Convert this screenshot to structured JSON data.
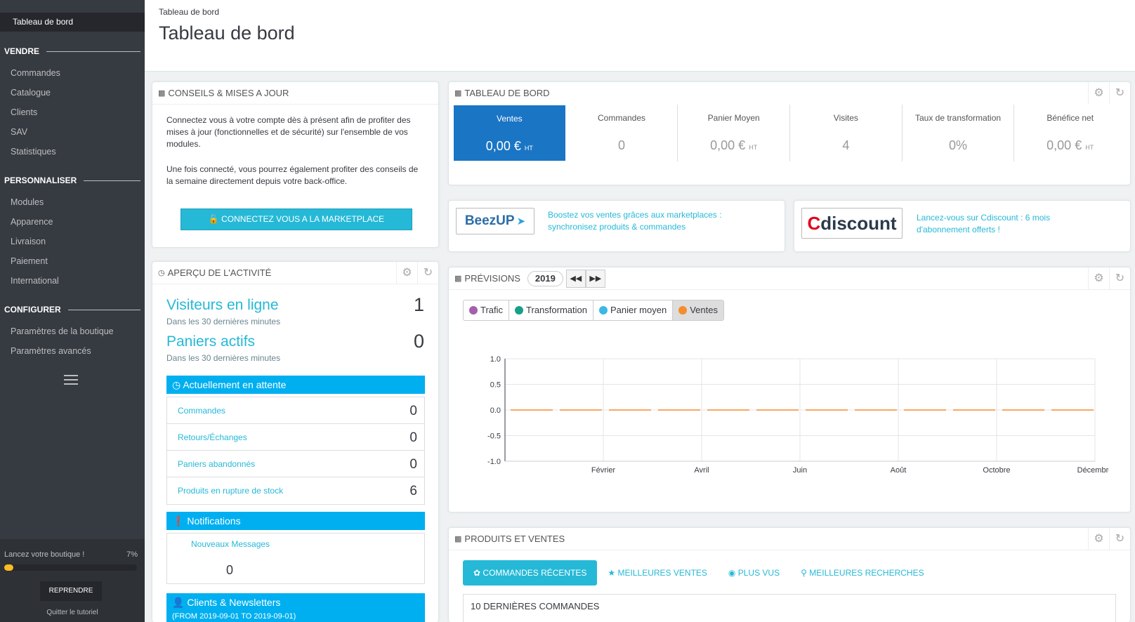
{
  "sidebar": {
    "active": "Tableau de bord",
    "sections": [
      {
        "title": "VENDRE",
        "items": [
          "Commandes",
          "Catalogue",
          "Clients",
          "SAV",
          "Statistiques"
        ]
      },
      {
        "title": "PERSONNALISER",
        "items": [
          "Modules",
          "Apparence",
          "Livraison",
          "Paiement",
          "International"
        ]
      },
      {
        "title": "CONFIGURER",
        "items": [
          "Paramètres de la boutique",
          "Paramètres avancés"
        ]
      }
    ],
    "launch_label": "Lancez votre boutique !",
    "launch_percent": "7%",
    "launch_progress": 0.07,
    "resume_button": "REPRENDRE",
    "quit_tutorial": "Quitter le tutoriel"
  },
  "header": {
    "breadcrumb": "Tableau de bord",
    "title": "Tableau de bord"
  },
  "tips": {
    "title": "CONSEILS & MISES A JOUR",
    "para1": "Connectez vous à votre compte dès à présent afin de profiter des mises à jour (fonctionnelles et de sécurité) sur l'ensemble de vos modules.",
    "para2": "Une fois connecté, vous pourrez également profiter des conseils de la semaine directement depuis votre back-office.",
    "button": "CONNECTEZ VOUS A LA MARKETPLACE PRESTASHOP"
  },
  "activity": {
    "title": "APERÇU DE L'ACTIVITÉ",
    "visitors_label": "Visiteurs en ligne",
    "visitors_sub": "Dans les 30 dernières minutes",
    "visitors_value": "1",
    "carts_label": "Paniers actifs",
    "carts_sub": "Dans les 30 dernières minutes",
    "carts_value": "0",
    "pending_title": "Actuellement en attente",
    "pending": [
      {
        "label": "Commandes",
        "value": "0"
      },
      {
        "label": "Retours/Échanges",
        "value": "0"
      },
      {
        "label": "Paniers abandonnés",
        "value": "0"
      },
      {
        "label": "Produits en rupture de stock",
        "value": "6"
      }
    ],
    "notifications_title": "Notifications",
    "new_messages_label": "Nouveaux Messages",
    "new_messages_value": "0",
    "clients_title": "Clients & Newsletters",
    "clients_range": "(FROM 2019-09-01 TO 2019-09-01)"
  },
  "dashboard": {
    "title": "TABLEAU DE BORD",
    "kpis": [
      {
        "label": "Ventes",
        "value": "0,00 €",
        "suffix": "HT"
      },
      {
        "label": "Commandes",
        "value": "0",
        "suffix": ""
      },
      {
        "label": "Panier Moyen",
        "value": "0,00 €",
        "suffix": "HT"
      },
      {
        "label": "Visites",
        "value": "4",
        "suffix": ""
      },
      {
        "label": "Taux de transformation",
        "value": "0%",
        "suffix": ""
      },
      {
        "label": "Bénéfice net",
        "value": "0,00 €",
        "suffix": "HT"
      }
    ]
  },
  "partners": {
    "beezup_logo": "BeezUP",
    "beezup_text": "Boostez vos ventes grâces aux marketplaces : synchronisez produits & commandes",
    "cdiscount_logo_c": "C",
    "cdiscount_logo_rest": "discount",
    "cdiscount_text": "Lancez-vous sur Cdiscount : 6 mois d'abonnement offerts !"
  },
  "previsions": {
    "title": "PRÉVISIONS",
    "year": "2019",
    "legend": [
      {
        "label": "Trafic",
        "color": "#a55eab"
      },
      {
        "label": "Transformation",
        "color": "#17a087"
      },
      {
        "label": "Panier moyen",
        "color": "#3ab8e6"
      },
      {
        "label": "Ventes",
        "color": "#f68c2d"
      }
    ]
  },
  "chart_data": {
    "type": "line",
    "x": [
      "Janvier",
      "Février",
      "Mars",
      "Avril",
      "Mai",
      "Juin",
      "Juillet",
      "Août",
      "Septembre",
      "Octobre",
      "Novembre",
      "Décembre"
    ],
    "x_tick_labels": [
      "Février",
      "Avril",
      "Juin",
      "Août",
      "Octobre",
      "Décembre"
    ],
    "series": [
      {
        "name": "Ventes",
        "values": [
          0,
          0,
          0,
          0,
          0,
          0,
          0,
          0,
          0,
          0,
          0,
          0
        ],
        "color": "#f68c2d"
      }
    ],
    "ylim": [
      -1.0,
      1.0
    ],
    "y_ticks": [
      "1.0",
      "0.5",
      "0.0",
      "-0.5",
      "-1.0"
    ],
    "grid": true
  },
  "products": {
    "title": "PRODUITS ET VENTES",
    "tabs": [
      "COMMANDES RÉCENTES",
      "MEILLEURES VENTES",
      "PLUS VUS",
      "MEILLEURES RECHERCHES"
    ],
    "recent_title": "10 DERNIÈRES COMMANDES"
  }
}
